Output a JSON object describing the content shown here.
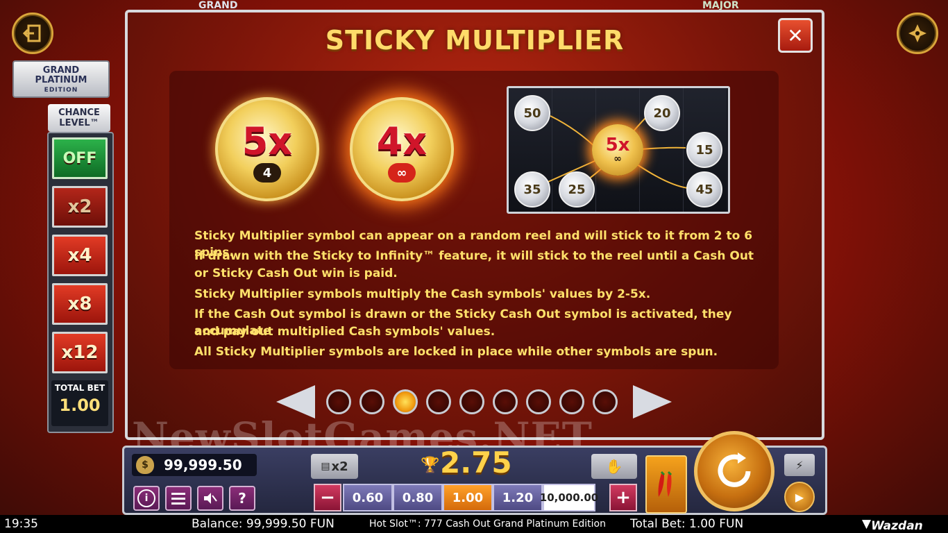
{
  "dialog": {
    "title": "STICKY MULTIPLIER",
    "close_label": "✕",
    "coins": [
      {
        "mult": "5x",
        "sub": "4"
      },
      {
        "mult": "4x",
        "sub": "∞"
      }
    ],
    "illustration": {
      "center": {
        "mult": "5x",
        "sub": "∞"
      },
      "values": [
        "50",
        "20",
        "15",
        "35",
        "25",
        "45"
      ]
    },
    "lines": [
      "Sticky Multiplier symbol can appear on a random reel and will stick to it from 2 to 6 spins.",
      "If drawn with the Sticky to Infinity™ feature, it will stick to the reel until a Cash Out",
      "or Sticky Cash Out win is paid.",
      "Sticky Multiplier symbols multiply the Cash symbols' values by 2-5x.",
      "If the Cash Out symbol is drawn or the Sticky Cash Out symbol is activated, they accumulate",
      "and pay out multiplied Cash symbols' values.",
      "All Sticky Multiplier symbols are locked in place while other symbols are spun."
    ],
    "pager": {
      "count": 9,
      "active_index": 2
    }
  },
  "left_panel": {
    "edition_line1": "GRAND",
    "edition_line2": "PLATINUM",
    "edition_line3": "EDITION",
    "chance_label_1": "CHANCE",
    "chance_label_2": "LEVEL™",
    "options": [
      "OFF",
      "x2",
      "x4",
      "x8",
      "x12"
    ],
    "total_bet_label": "TOTAL BET",
    "total_bet_value": "1.00"
  },
  "background_labels": {
    "left": "GRAND",
    "right": "MAJOR"
  },
  "console": {
    "balance": "99,999.50",
    "x2_label": "x2",
    "win_value": "2.75",
    "bet_options": [
      "0.60",
      "0.80",
      "1.00",
      "1.20",
      "10,000.00"
    ],
    "selected_bet": "1.00",
    "minus": "−",
    "plus": "+",
    "help": "?",
    "info": "i"
  },
  "watermark": "NewSlotGames.NET",
  "status_bar": {
    "time": "19:35",
    "balance": "Balance: 99,999.50 FUN",
    "game_title": "Hot Slot™: 777 Cash Out Grand Platinum Edition",
    "total_bet": "Total Bet: 1.00 FUN",
    "brand": "Wazdan"
  },
  "colors": {
    "title": "#ffdb6a",
    "text": "#ffe06a",
    "accent": "#f09a10"
  }
}
